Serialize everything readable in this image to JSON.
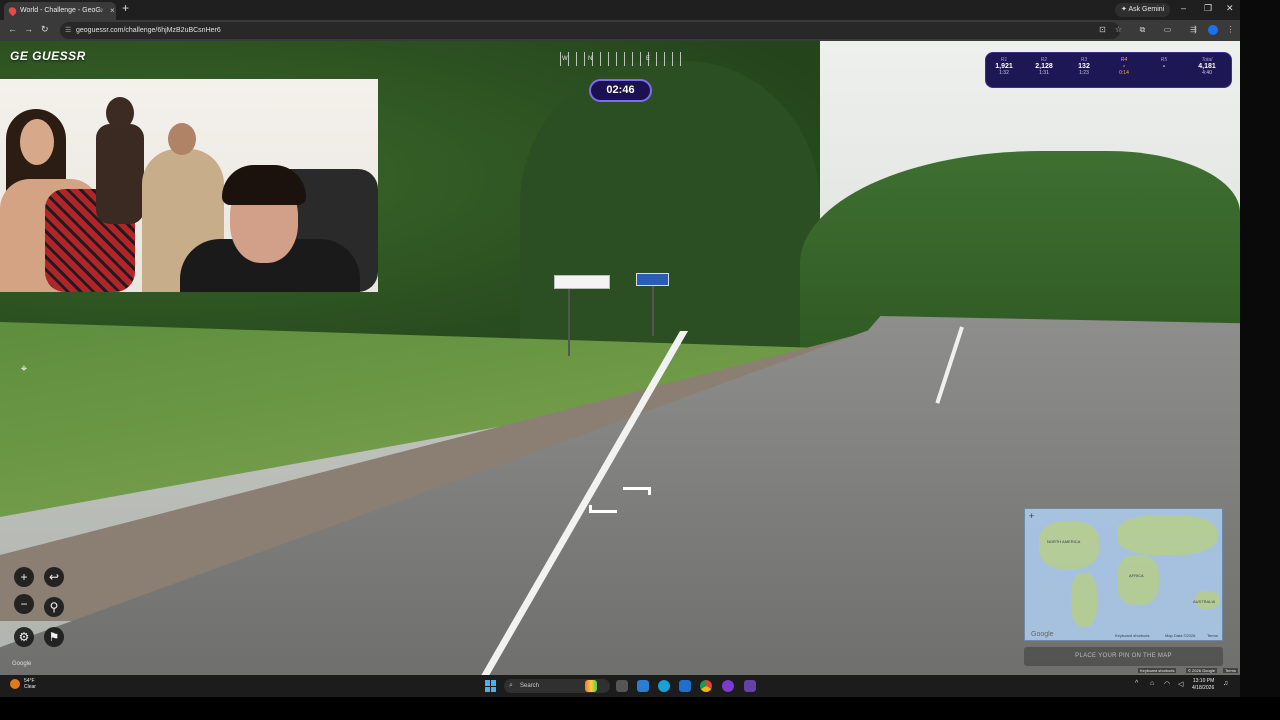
{
  "browser": {
    "tab_title": "World - Challenge - GeoG",
    "new_tab": "+",
    "url": "geoguessr.com/challenge/6hjMzB2uBCsnHer6",
    "ask_gemini": "Ask Gemini"
  },
  "game": {
    "logo": "GE  GUESSR",
    "timer": "02:46",
    "compass": [
      "W",
      "N",
      "E"
    ],
    "rounds": [
      {
        "label": "R1",
        "score": "1,921",
        "time": "1:32"
      },
      {
        "label": "R2",
        "score": "2,128",
        "time": "1:31"
      },
      {
        "label": "R3",
        "score": "132",
        "time": "1:23"
      },
      {
        "label": "R4",
        "score": "-",
        "time": "0:14"
      },
      {
        "label": "R5",
        "score": "-",
        "time": ""
      },
      {
        "label": "Total",
        "score": "4,181",
        "time": "4:40"
      }
    ],
    "minimap": {
      "labels": [
        "NORTH AMERICA",
        "AFRICA",
        "AUSTRALIA"
      ],
      "footer_left": "Keyboard shortcuts",
      "footer_mid": "Map Data ©2026",
      "footer_right": "Terms",
      "google": "Google"
    },
    "guess_placeholder": "PLACE YOUR PIN ON THE MAP",
    "attribution": [
      "Keyboard shortcuts",
      "© 2026 Google",
      "Terms"
    ],
    "google_mark": "Google"
  },
  "taskbar": {
    "weather_temp": "54°F",
    "weather_cond": "Clear",
    "search": "Search",
    "time": "13:10 PM",
    "date": "4/18/2026"
  }
}
